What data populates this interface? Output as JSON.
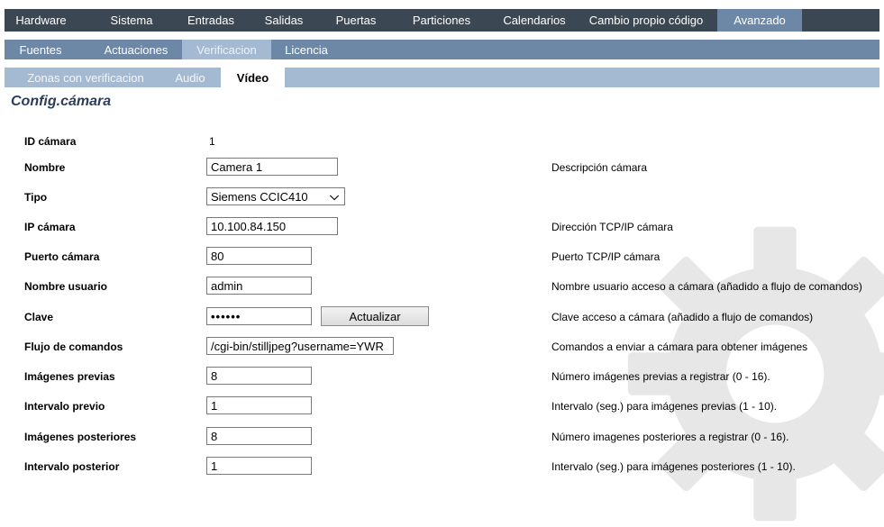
{
  "nav": {
    "primary": [
      "Hardware",
      "Sistema",
      "Entradas",
      "Salidas",
      "Puertas",
      "Particiones",
      "Calendarios",
      "Cambio propio código",
      "Avanzado"
    ],
    "primary_active": "Avanzado",
    "secondary": [
      "Fuentes",
      "Actuaciones",
      "Verificacion",
      "Licencia"
    ],
    "secondary_active": "Verificacion",
    "tertiary": [
      "Zonas con verificacion",
      "Audio",
      "Vídeo"
    ],
    "tertiary_active": "Vídeo"
  },
  "page": {
    "title": "Config.cámara"
  },
  "form": {
    "id": {
      "label": "ID cámara",
      "value": "1"
    },
    "name": {
      "label": "Nombre",
      "value": "Camera 1",
      "desc": "Descripción cámara"
    },
    "type": {
      "label": "Tipo",
      "value": "Siemens CCIC410"
    },
    "ip": {
      "label": "IP cámara",
      "value": "10.100.84.150",
      "desc": "Dirección TCP/IP cámara"
    },
    "port": {
      "label": "Puerto cámara",
      "value": "80",
      "desc": "Puerto TCP/IP cámara"
    },
    "user": {
      "label": "Nombre usuario",
      "value": "admin",
      "desc": "Nombre usuario acceso a cámara (añadido a flujo de comandos)"
    },
    "password": {
      "label": "Clave",
      "value": "••••••",
      "button": "Actualizar",
      "desc": "Clave acceso a cámara (añadido a flujo de comandos)"
    },
    "command": {
      "label": "Flujo de comandos",
      "value": "/cgi-bin/stilljpeg?username=YWR",
      "desc": "Comandos a enviar a cámara para obtener imágenes"
    },
    "pre_images": {
      "label": "Imágenes previas",
      "value": "8",
      "desc": "Número imágenes previas a registrar (0 - 16)."
    },
    "pre_interval": {
      "label": "Intervalo previo",
      "value": "1",
      "desc": "Intervalo (seg.) para imágenes previas (1 - 10)."
    },
    "post_images": {
      "label": "Imágenes posteriores",
      "value": "8",
      "desc": "Número imagenes posteriores a registrar (0 - 16)."
    },
    "post_interval": {
      "label": "Intervalo posterior",
      "value": "1",
      "desc": "Intervalo (seg.) para imágenes posteriores (1 - 10)."
    }
  },
  "icons": {
    "watermark": "gear-icon",
    "select_arrow": "chevron-down-icon"
  }
}
